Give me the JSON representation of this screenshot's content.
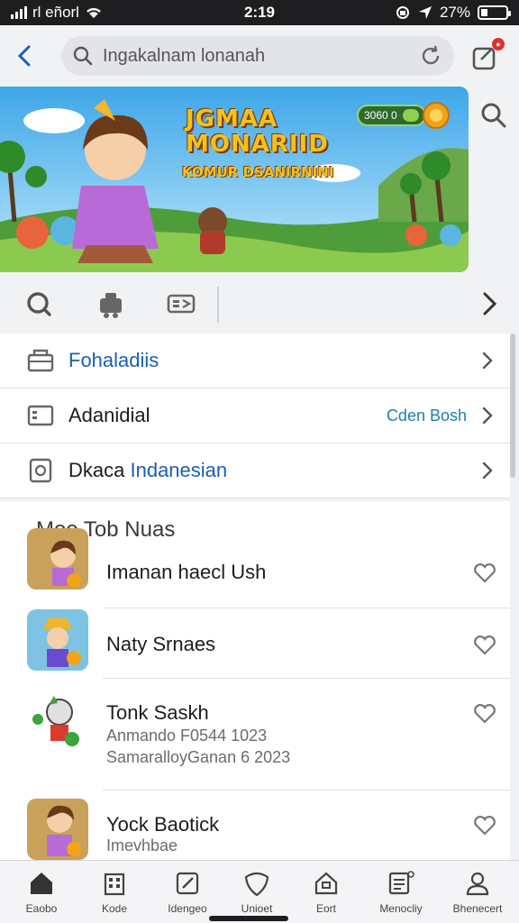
{
  "status": {
    "carrier": "rl eñorl",
    "time": "2:19",
    "battery": "27%",
    "battery_level": 0.27
  },
  "header": {
    "search_text": "Ingakalnam lonanah"
  },
  "banner": {
    "title_line1": "JGMAA",
    "title_line2": "MONARIID",
    "subtitle": "KOMUR DSANIRNINI",
    "coin_text": "3060 0"
  },
  "menu": [
    {
      "label": "Fohaladiis",
      "label_blue": "",
      "value": "",
      "icon": "folder-icon"
    },
    {
      "label": "Adanidial",
      "label_blue": "",
      "value": "Cden Bosh",
      "icon": "card-icon"
    },
    {
      "label": "Dkaca ",
      "label_blue": "Indanesian",
      "value": "",
      "icon": "document-icon"
    }
  ],
  "list": {
    "title": "Moo  Tob Nuas",
    "items": [
      {
        "name": "Imanan haecl Ush",
        "sub1": "",
        "sub2": ""
      },
      {
        "name": "Naty Srnaes",
        "sub1": "",
        "sub2": ""
      },
      {
        "name": "Tonk Saskh",
        "sub1": "Anmando F0544 1023",
        "sub2": "SamaralloyGanan 6 2023"
      },
      {
        "name": "Yock Baotick",
        "sub1": "Imevhbae",
        "sub2": ""
      }
    ]
  },
  "tabs": [
    {
      "label": "Eaobo",
      "icon": "home-icon"
    },
    {
      "label": "Kode",
      "icon": "building-icon"
    },
    {
      "label": "Idengeo",
      "icon": "edit-icon"
    },
    {
      "label": "Unioet",
      "icon": "shield-icon"
    },
    {
      "label": "Eort",
      "icon": "house-outline-icon"
    },
    {
      "label": "Menocliy",
      "icon": "list-icon"
    },
    {
      "label": "Bhenecert",
      "icon": "person-icon"
    }
  ],
  "colors": {
    "accent": "#1a5fb4",
    "value_text": "#1d7fa8",
    "status_bar": "#1e1e20",
    "badge": "#e03030",
    "banner_title": "#f6c21a"
  }
}
